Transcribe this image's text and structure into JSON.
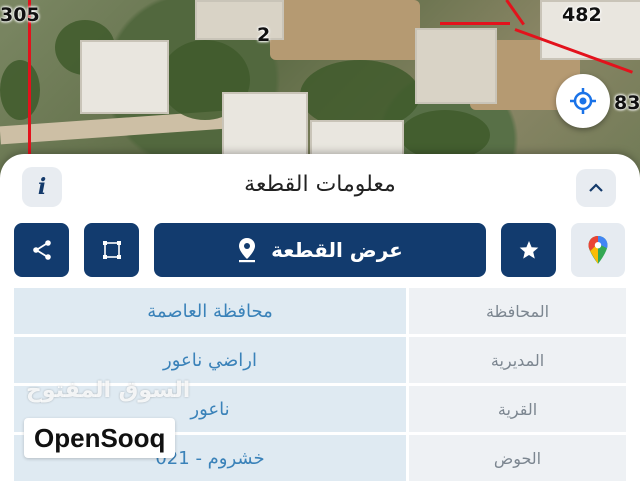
{
  "map": {
    "parcel_labels": {
      "top_left": "305",
      "center": "2",
      "top_right": "482",
      "right_edge": "83"
    },
    "locate_icon": "crosshair-locate-icon"
  },
  "sheet": {
    "title": "معلومات القطعة",
    "info_icon_text": "i",
    "collapse_icon": "chevron-up-icon",
    "actions": {
      "share_icon": "share-icon",
      "crop_icon": "crop-area-icon",
      "show_parcel_label": "عرض القطعة",
      "pin_icon": "map-pin-icon",
      "star_icon": "star-icon",
      "google_maps_icon": "google-maps-pin-icon"
    },
    "rows": [
      {
        "key": "المحافظة",
        "value": "محافظة العاصمة"
      },
      {
        "key": "المديرية",
        "value": "اراضي ناعور"
      },
      {
        "key": "القرية",
        "value": "ناعور"
      },
      {
        "key": "الحوض",
        "value": "خشروم - 021"
      }
    ]
  },
  "watermark": {
    "arabic": "السوق المفتوح",
    "english": "OpenSooq"
  },
  "colors": {
    "primary": "#123b6e",
    "value_text": "#3a82b9",
    "parcel_line": "#e3121c"
  }
}
